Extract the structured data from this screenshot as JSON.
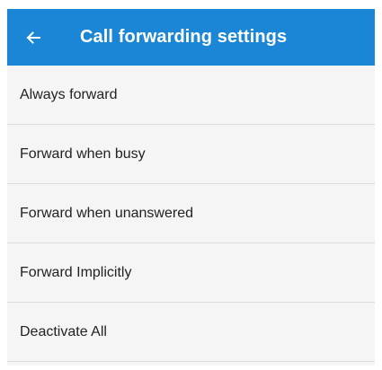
{
  "app_bar": {
    "title": "Call forwarding settings",
    "back_icon": "arrow-left-icon",
    "background_color": "#1b86d6"
  },
  "menu": {
    "items": [
      {
        "label": "Always forward"
      },
      {
        "label": "Forward when busy"
      },
      {
        "label": "Forward when unanswered"
      },
      {
        "label": "Forward Implicitly"
      },
      {
        "label": "Deactivate All"
      }
    ]
  }
}
